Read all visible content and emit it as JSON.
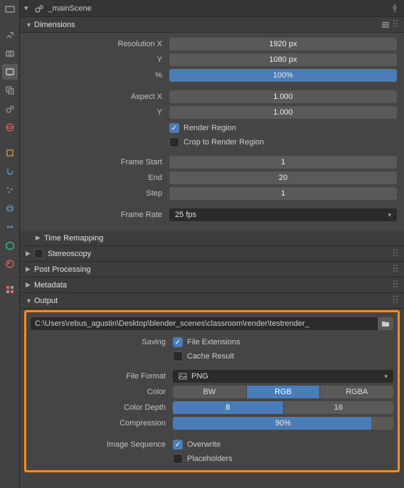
{
  "scene_name": "_mainScene",
  "panels": {
    "dimensions": {
      "title": "Dimensions",
      "expanded": true
    },
    "time_remapping": {
      "title": "Time Remapping"
    },
    "stereoscopy": {
      "title": "Stereoscopy"
    },
    "post_processing": {
      "title": "Post Processing"
    },
    "metadata": {
      "title": "Metadata"
    },
    "output": {
      "title": "Output",
      "expanded": true
    }
  },
  "dimensions": {
    "resolution_x_label": "Resolution X",
    "resolution_x": "1920 px",
    "resolution_y_label": "Y",
    "resolution_y": "1080 px",
    "percent_label": "%",
    "percent": "100%",
    "aspect_x_label": "Aspect X",
    "aspect_x": "1.000",
    "aspect_y_label": "Y",
    "aspect_y": "1.000",
    "render_region_label": "Render Region",
    "render_region_checked": true,
    "crop_region_label": "Crop to Render Region",
    "crop_region_checked": false,
    "frame_start_label": "Frame Start",
    "frame_start": "1",
    "frame_end_label": "End",
    "frame_end": "20",
    "frame_step_label": "Step",
    "frame_step": "1",
    "frame_rate_label": "Frame Rate",
    "frame_rate": "25 fps"
  },
  "output": {
    "path": "C:\\Users\\rebus_agustin\\Desktop\\blender_scenes\\classroom\\render\\testrender_",
    "saving_label": "Saving",
    "file_extensions_label": "File Extensions",
    "file_extensions_checked": true,
    "cache_result_label": "Cache Result",
    "cache_result_checked": false,
    "file_format_label": "File Format",
    "file_format": "PNG",
    "color_label": "Color",
    "color_options": [
      "BW",
      "RGB",
      "RGBA"
    ],
    "color_selected": "RGB",
    "color_depth_label": "Color Depth",
    "color_depth_options": [
      "8",
      "16"
    ],
    "color_depth_selected": "8",
    "compression_label": "Compression",
    "compression": "90%",
    "compression_pct": 90,
    "image_sequence_label": "Image Sequence",
    "overwrite_label": "Overwrite",
    "overwrite_checked": true,
    "placeholders_label": "Placeholders",
    "placeholders_checked": false
  }
}
